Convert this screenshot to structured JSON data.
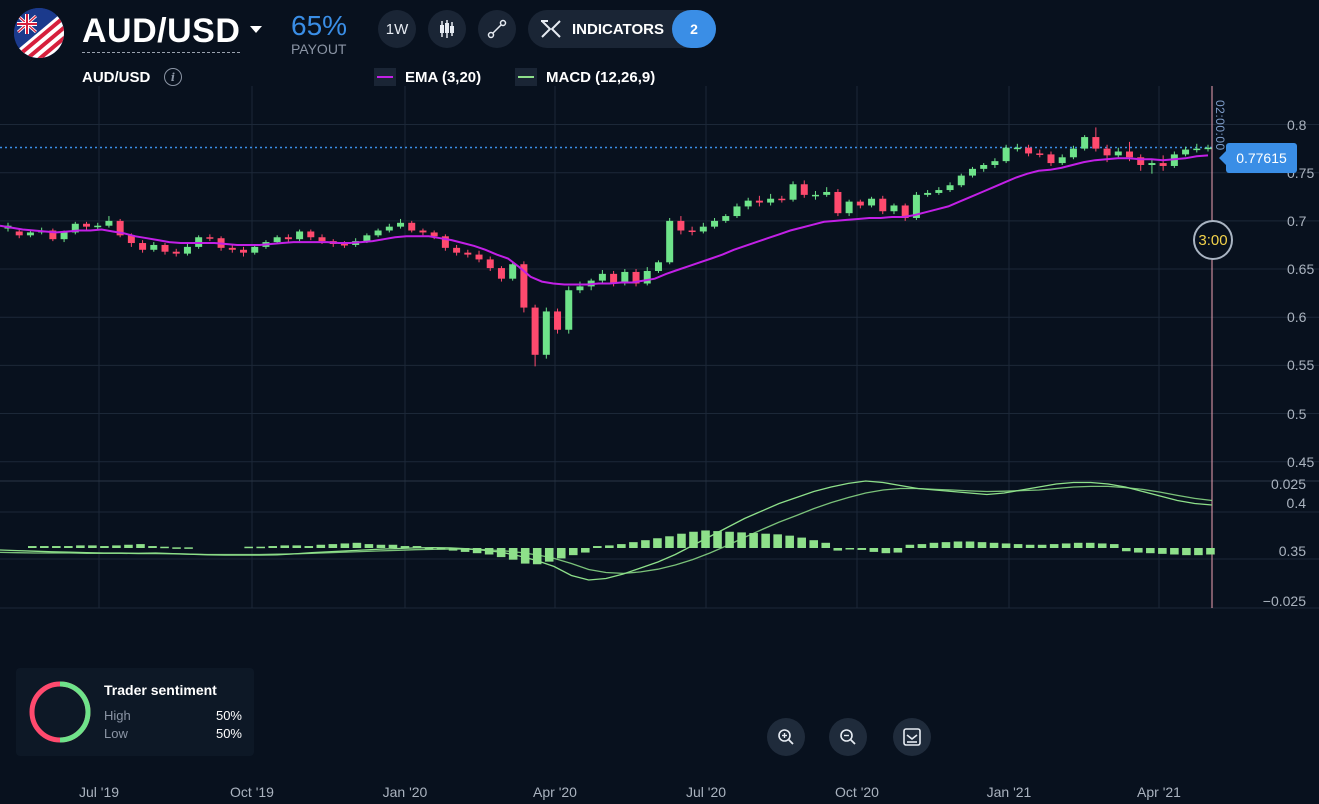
{
  "header": {
    "pair": "AUD/USD",
    "payout_value": "65%",
    "payout_label": "PAYOUT",
    "timeframe": "1W",
    "indicators_label": "INDICATORS",
    "indicators_count": "2"
  },
  "legend": {
    "pair": "AUD/USD",
    "ema_label": "EMA (3,20)",
    "macd_label": "MACD (12,26,9)"
  },
  "colors": {
    "up": "#6ee38a",
    "down": "#ff4a6e",
    "ema": "#c220e6",
    "macd": "#8ee08a",
    "accent": "#3a8ee6"
  },
  "price_axis": [
    "0.8",
    "0.75",
    "0.7",
    "0.65",
    "0.6",
    "0.55",
    "0.5",
    "0.45"
  ],
  "macd_axis": [
    "0.025",
    "0.4",
    "0.35",
    "−0.025"
  ],
  "x_axis": [
    "Jul '19",
    "Oct '19",
    "Jan '20",
    "Apr '20",
    "Jul '20",
    "Oct '20",
    "Jan '21",
    "Apr '21"
  ],
  "current_price": "0.77615",
  "timer": "3:00",
  "vertical_time": "02:00:00",
  "sentiment": {
    "title": "Trader sentiment",
    "high_label": "High",
    "high_value": "50%",
    "low_label": "Low",
    "low_value": "50%",
    "high_color": "#6ee38a",
    "low_color": "#ff4a6e"
  },
  "chart_data": {
    "type": "candlestick",
    "ylim": [
      0.43,
      0.84
    ],
    "candles": [
      [
        0.692,
        0.695,
        0.698,
        0.689
      ],
      [
        0.689,
        0.685,
        0.691,
        0.682
      ],
      [
        0.685,
        0.688,
        0.69,
        0.683
      ],
      [
        0.688,
        0.69,
        0.693,
        0.686
      ],
      [
        0.69,
        0.681,
        0.692,
        0.679
      ],
      [
        0.681,
        0.688,
        0.69,
        0.678
      ],
      [
        0.688,
        0.697,
        0.699,
        0.686
      ],
      [
        0.697,
        0.694,
        0.699,
        0.691
      ],
      [
        0.694,
        0.695,
        0.698,
        0.69
      ],
      [
        0.695,
        0.7,
        0.705,
        0.693
      ],
      [
        0.7,
        0.685,
        0.702,
        0.683
      ],
      [
        0.685,
        0.677,
        0.687,
        0.673
      ],
      [
        0.677,
        0.67,
        0.68,
        0.667
      ],
      [
        0.67,
        0.675,
        0.678,
        0.668
      ],
      [
        0.675,
        0.668,
        0.677,
        0.665
      ],
      [
        0.668,
        0.666,
        0.671,
        0.663
      ],
      [
        0.666,
        0.673,
        0.676,
        0.664
      ],
      [
        0.673,
        0.683,
        0.685,
        0.671
      ],
      [
        0.683,
        0.682,
        0.686,
        0.679
      ],
      [
        0.682,
        0.672,
        0.684,
        0.669
      ],
      [
        0.672,
        0.67,
        0.675,
        0.667
      ],
      [
        0.67,
        0.667,
        0.673,
        0.663
      ],
      [
        0.667,
        0.673,
        0.676,
        0.665
      ],
      [
        0.673,
        0.678,
        0.68,
        0.671
      ],
      [
        0.678,
        0.683,
        0.685,
        0.676
      ],
      [
        0.683,
        0.681,
        0.686,
        0.678
      ],
      [
        0.681,
        0.689,
        0.691,
        0.679
      ],
      [
        0.689,
        0.683,
        0.691,
        0.68
      ],
      [
        0.683,
        0.679,
        0.686,
        0.676
      ],
      [
        0.679,
        0.676,
        0.681,
        0.673
      ],
      [
        0.676,
        0.675,
        0.679,
        0.672
      ],
      [
        0.675,
        0.679,
        0.682,
        0.673
      ],
      [
        0.679,
        0.685,
        0.687,
        0.677
      ],
      [
        0.685,
        0.69,
        0.692,
        0.683
      ],
      [
        0.69,
        0.694,
        0.697,
        0.688
      ],
      [
        0.694,
        0.698,
        0.702,
        0.692
      ],
      [
        0.698,
        0.69,
        0.7,
        0.688
      ],
      [
        0.69,
        0.688,
        0.692,
        0.685
      ],
      [
        0.688,
        0.684,
        0.69,
        0.681
      ],
      [
        0.684,
        0.672,
        0.686,
        0.669
      ],
      [
        0.672,
        0.667,
        0.675,
        0.664
      ],
      [
        0.667,
        0.665,
        0.67,
        0.662
      ],
      [
        0.665,
        0.66,
        0.669,
        0.657
      ],
      [
        0.66,
        0.651,
        0.663,
        0.648
      ],
      [
        0.651,
        0.64,
        0.653,
        0.637
      ],
      [
        0.64,
        0.655,
        0.657,
        0.638
      ],
      [
        0.655,
        0.61,
        0.658,
        0.605
      ],
      [
        0.61,
        0.561,
        0.613,
        0.549
      ],
      [
        0.561,
        0.606,
        0.61,
        0.557
      ],
      [
        0.606,
        0.587,
        0.609,
        0.583
      ],
      [
        0.587,
        0.628,
        0.632,
        0.583
      ],
      [
        0.628,
        0.632,
        0.637,
        0.625
      ],
      [
        0.632,
        0.638,
        0.64,
        0.628
      ],
      [
        0.638,
        0.645,
        0.649,
        0.635
      ],
      [
        0.645,
        0.635,
        0.648,
        0.632
      ],
      [
        0.635,
        0.647,
        0.65,
        0.633
      ],
      [
        0.647,
        0.635,
        0.65,
        0.632
      ],
      [
        0.635,
        0.648,
        0.652,
        0.633
      ],
      [
        0.648,
        0.657,
        0.659,
        0.646
      ],
      [
        0.657,
        0.7,
        0.703,
        0.655
      ],
      [
        0.7,
        0.69,
        0.705,
        0.686
      ],
      [
        0.69,
        0.689,
        0.694,
        0.685
      ],
      [
        0.689,
        0.694,
        0.698,
        0.687
      ],
      [
        0.694,
        0.7,
        0.703,
        0.692
      ],
      [
        0.7,
        0.705,
        0.707,
        0.698
      ],
      [
        0.705,
        0.715,
        0.718,
        0.703
      ],
      [
        0.715,
        0.721,
        0.724,
        0.712
      ],
      [
        0.721,
        0.719,
        0.726,
        0.715
      ],
      [
        0.719,
        0.723,
        0.728,
        0.716
      ],
      [
        0.723,
        0.722,
        0.726,
        0.719
      ],
      [
        0.722,
        0.738,
        0.741,
        0.72
      ],
      [
        0.738,
        0.727,
        0.742,
        0.724
      ],
      [
        0.727,
        0.727,
        0.731,
        0.722
      ],
      [
        0.727,
        0.73,
        0.735,
        0.725
      ],
      [
        0.73,
        0.708,
        0.733,
        0.705
      ],
      [
        0.708,
        0.72,
        0.722,
        0.705
      ],
      [
        0.72,
        0.716,
        0.722,
        0.713
      ],
      [
        0.716,
        0.723,
        0.725,
        0.714
      ],
      [
        0.723,
        0.71,
        0.726,
        0.707
      ],
      [
        0.71,
        0.716,
        0.718,
        0.707
      ],
      [
        0.716,
        0.703,
        0.718,
        0.7
      ],
      [
        0.703,
        0.727,
        0.73,
        0.701
      ],
      [
        0.727,
        0.729,
        0.732,
        0.725
      ],
      [
        0.729,
        0.732,
        0.735,
        0.727
      ],
      [
        0.732,
        0.737,
        0.74,
        0.73
      ],
      [
        0.737,
        0.747,
        0.749,
        0.735
      ],
      [
        0.747,
        0.754,
        0.756,
        0.745
      ],
      [
        0.754,
        0.758,
        0.76,
        0.751
      ],
      [
        0.758,
        0.762,
        0.765,
        0.755
      ],
      [
        0.762,
        0.776,
        0.779,
        0.76
      ],
      [
        0.776,
        0.776,
        0.78,
        0.772
      ],
      [
        0.776,
        0.77,
        0.779,
        0.767
      ],
      [
        0.77,
        0.769,
        0.774,
        0.766
      ],
      [
        0.769,
        0.76,
        0.772,
        0.757
      ],
      [
        0.76,
        0.766,
        0.769,
        0.758
      ],
      [
        0.766,
        0.775,
        0.778,
        0.764
      ],
      [
        0.775,
        0.787,
        0.789,
        0.773
      ],
      [
        0.787,
        0.775,
        0.797,
        0.772
      ],
      [
        0.775,
        0.768,
        0.779,
        0.761
      ],
      [
        0.768,
        0.772,
        0.776,
        0.766
      ],
      [
        0.772,
        0.766,
        0.782,
        0.762
      ],
      [
        0.766,
        0.758,
        0.769,
        0.752
      ],
      [
        0.758,
        0.76,
        0.764,
        0.749
      ],
      [
        0.76,
        0.757,
        0.768,
        0.752
      ],
      [
        0.757,
        0.769,
        0.772,
        0.755
      ],
      [
        0.769,
        0.774,
        0.777,
        0.767
      ],
      [
        0.774,
        0.775,
        0.78,
        0.771
      ],
      [
        0.775,
        0.776,
        0.779,
        0.772
      ]
    ],
    "ema": [
      0.695,
      0.693,
      0.691,
      0.69,
      0.689,
      0.688,
      0.689,
      0.69,
      0.69,
      0.691,
      0.689,
      0.687,
      0.684,
      0.682,
      0.68,
      0.678,
      0.677,
      0.677,
      0.677,
      0.677,
      0.676,
      0.675,
      0.675,
      0.675,
      0.676,
      0.677,
      0.678,
      0.678,
      0.678,
      0.678,
      0.677,
      0.677,
      0.678,
      0.679,
      0.681,
      0.683,
      0.684,
      0.684,
      0.684,
      0.682,
      0.68,
      0.677,
      0.674,
      0.67,
      0.665,
      0.661,
      0.652,
      0.642,
      0.637,
      0.635,
      0.634,
      0.634,
      0.634,
      0.635,
      0.635,
      0.636,
      0.636,
      0.638,
      0.64,
      0.645,
      0.649,
      0.653,
      0.657,
      0.661,
      0.665,
      0.67,
      0.674,
      0.678,
      0.682,
      0.686,
      0.69,
      0.693,
      0.696,
      0.699,
      0.7,
      0.701,
      0.702,
      0.703,
      0.703,
      0.704,
      0.704,
      0.706,
      0.709,
      0.712,
      0.715,
      0.72,
      0.725,
      0.73,
      0.735,
      0.74,
      0.745,
      0.749,
      0.752,
      0.753,
      0.755,
      0.758,
      0.761,
      0.763,
      0.764,
      0.765,
      0.765,
      0.764,
      0.764,
      0.763,
      0.764,
      0.765,
      0.767,
      0.768
    ],
    "macd_hist": [
      0.3,
      0.3,
      0.3,
      0.3,
      0.4,
      0.4,
      0.3,
      0.4,
      0.5,
      0.6,
      0.3,
      0.2,
      0.1,
      0.1,
      0.1,
      0.1,
      0.1,
      0.1,
      0.2,
      0.2,
      0.3,
      0.4,
      0.4,
      0.3,
      0.5,
      0.6,
      0.7,
      0.8,
      0.6,
      0.5,
      0.5,
      0.3,
      0.3,
      0.2,
      0.2,
      0.4,
      0.6,
      0.8,
      1.0,
      1.4,
      1.8,
      2.4,
      2.5,
      2.1,
      1.6,
      1.1,
      0.7,
      0.3,
      0.4,
      0.6,
      0.9,
      1.2,
      1.5,
      1.8,
      2.2,
      2.5,
      2.7,
      2.6,
      2.5,
      2.4,
      2.3,
      2.2,
      2.1,
      1.9,
      1.6,
      1.2,
      0.8,
      0.4,
      0.1,
      0.3,
      0.6,
      0.8,
      0.7,
      0.5,
      0.6,
      0.8,
      0.9,
      1.0,
      1.0,
      0.9,
      0.8,
      0.7,
      0.6,
      0.5,
      0.5,
      0.6,
      0.7,
      0.8,
      0.8,
      0.7,
      0.6,
      0.5,
      0.7,
      0.8,
      0.9,
      1.0,
      1.1,
      1.1,
      1.0
    ],
    "macd_hist_sign": [
      1,
      1,
      1,
      1,
      1,
      1,
      1,
      1,
      1,
      1,
      1,
      1,
      1,
      1,
      0,
      0,
      0,
      0,
      1,
      1,
      1,
      1,
      1,
      1,
      1,
      1,
      1,
      1,
      1,
      1,
      1,
      1,
      1,
      -1,
      -1,
      -1,
      -1,
      -1,
      -1,
      -1,
      -1,
      -1,
      -1,
      -1,
      -1,
      -1,
      -1,
      1,
      1,
      1,
      1,
      1,
      1,
      1,
      1,
      1,
      1,
      1,
      1,
      1,
      1,
      1,
      1,
      1,
      1,
      1,
      1,
      -1,
      -1,
      -1,
      -1,
      -1,
      -1,
      1,
      1,
      1,
      1,
      1,
      1,
      1,
      1,
      1,
      1,
      1,
      1,
      1,
      1,
      1,
      1,
      1,
      1,
      -1,
      -1,
      -1,
      -1,
      -1,
      -1,
      -1,
      -1
    ],
    "macd_line": [
      0.4,
      0.38,
      0.36,
      0.34,
      0.33,
      0.31,
      0.3,
      0.3,
      0.29,
      0.3,
      0.28,
      0.26,
      0.24,
      0.23,
      0.23,
      0.23,
      0.24,
      0.27,
      0.31,
      0.34,
      0.37,
      0.4,
      0.43,
      0.45,
      0.47,
      0.48,
      0.47,
      0.44,
      0.39,
      0.32,
      0.2,
      0.05,
      -0.15,
      -0.45,
      -0.6,
      -0.55,
      -0.4,
      -0.2,
      0.0,
      0.25,
      0.55,
      0.85,
      1.15,
      1.45,
      1.7,
      1.95,
      2.15,
      2.35,
      2.5,
      2.62,
      2.7,
      2.65,
      2.55,
      2.45,
      2.4,
      2.35,
      2.3,
      2.25,
      2.3,
      2.4,
      2.5,
      2.6,
      2.65,
      2.65,
      2.6,
      2.5,
      2.35,
      2.2,
      2.05,
      1.95,
      1.9
    ],
    "signal_line": [
      0.32,
      0.31,
      0.3,
      0.3,
      0.3,
      0.29,
      0.29,
      0.29,
      0.28,
      0.28,
      0.27,
      0.26,
      0.25,
      0.25,
      0.25,
      0.25,
      0.26,
      0.27,
      0.29,
      0.31,
      0.33,
      0.35,
      0.37,
      0.39,
      0.41,
      0.42,
      0.43,
      0.43,
      0.41,
      0.38,
      0.32,
      0.24,
      0.12,
      -0.05,
      -0.25,
      -0.35,
      -0.38,
      -0.33,
      -0.24,
      -0.1,
      0.08,
      0.3,
      0.55,
      0.82,
      1.08,
      1.33,
      1.55,
      1.78,
      1.98,
      2.15,
      2.3,
      2.4,
      2.45,
      2.45,
      2.42,
      2.4,
      2.37,
      2.35,
      2.36,
      2.38,
      2.4,
      2.45,
      2.5,
      2.52,
      2.52,
      2.48,
      2.42,
      2.33,
      2.22,
      2.12,
      2.05
    ]
  }
}
